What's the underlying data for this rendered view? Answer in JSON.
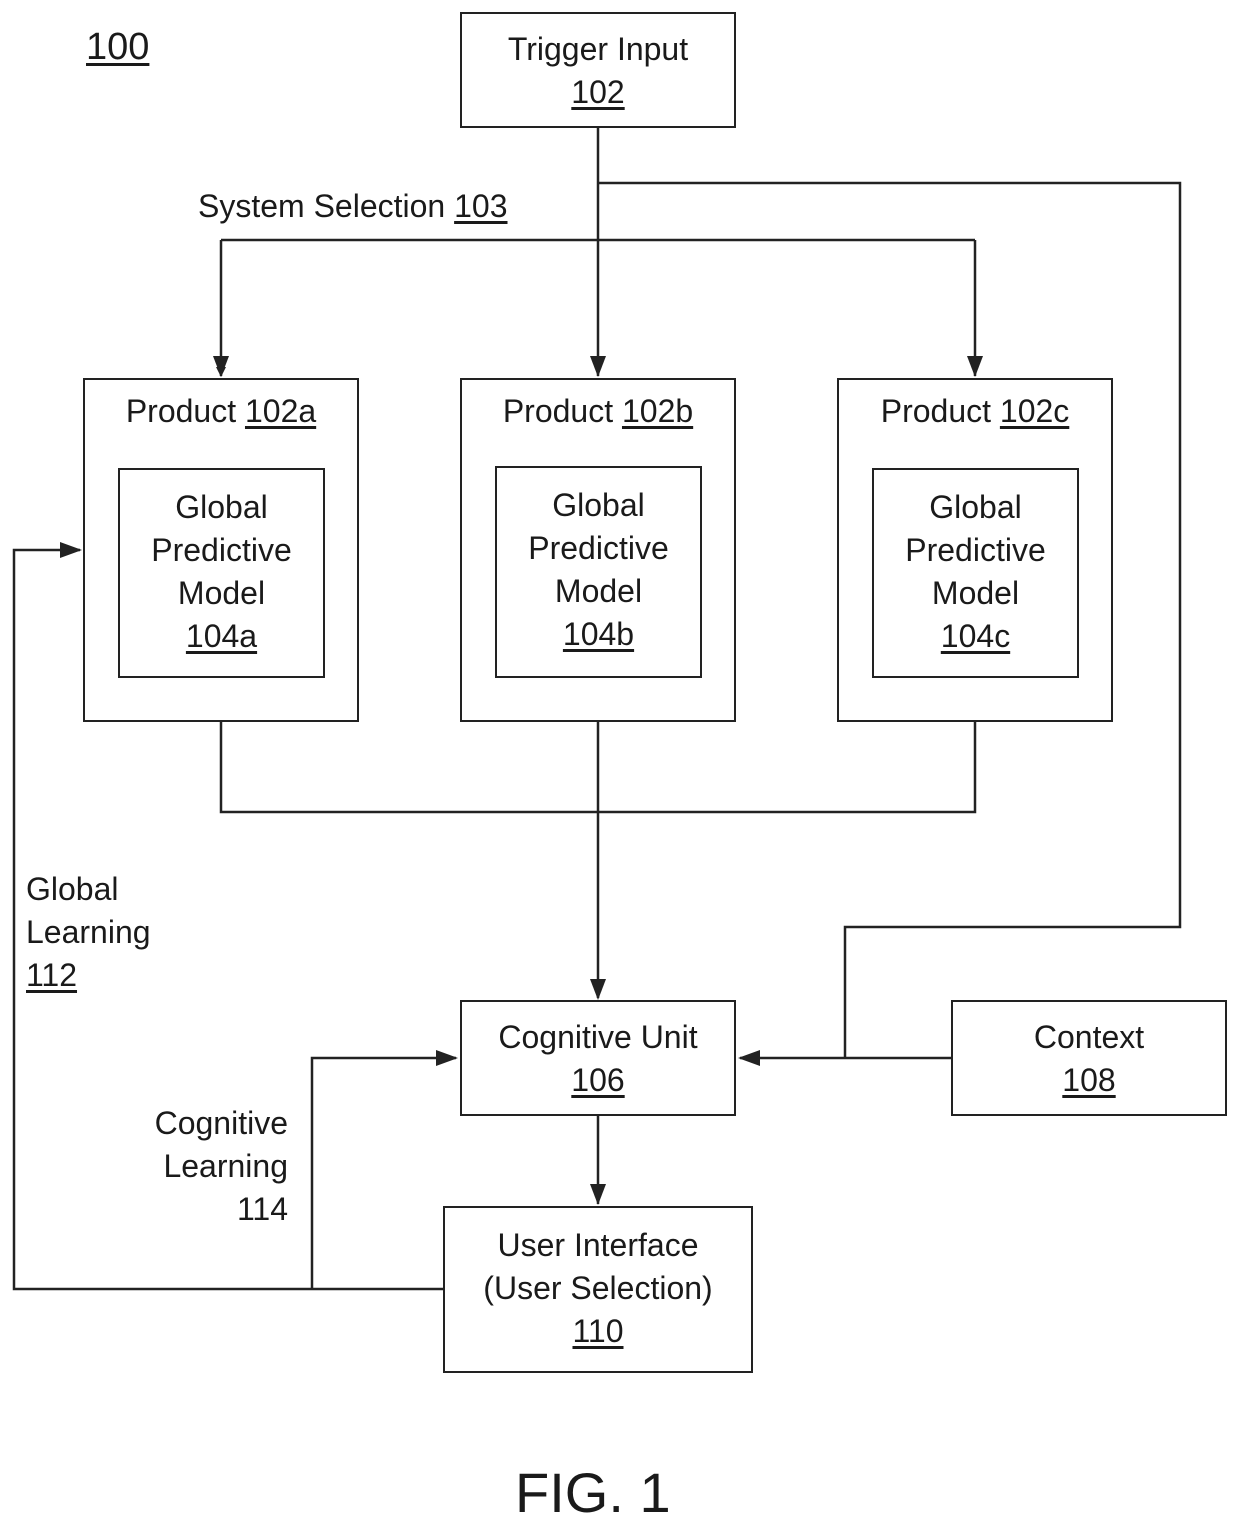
{
  "diagram": {
    "figure_ref": "100",
    "figure_caption": "FIG. 1",
    "line_color": "#222222",
    "nodes": {
      "trigger_input": {
        "label": "Trigger Input",
        "ref": "102"
      },
      "product_a": {
        "label": "Product",
        "ref": "102a",
        "model": {
          "label_lines": [
            "Global",
            "Predictive",
            "Model"
          ],
          "ref": "104a"
        }
      },
      "product_b": {
        "label": "Product",
        "ref": "102b",
        "model": {
          "label_lines": [
            "Global",
            "Predictive",
            "Model"
          ],
          "ref": "104b"
        }
      },
      "product_c": {
        "label": "Product",
        "ref": "102c",
        "model": {
          "label_lines": [
            "Global",
            "Predictive",
            "Model"
          ],
          "ref": "104c"
        }
      },
      "cognitive_unit": {
        "label": "Cognitive Unit",
        "ref": "106"
      },
      "context": {
        "label": "Context",
        "ref": "108"
      },
      "user_interface": {
        "label_lines": [
          "User Interface",
          "(User Selection)"
        ],
        "ref": "110"
      }
    },
    "edge_labels": {
      "system_selection": {
        "label": "System Selection",
        "ref": "103"
      },
      "global_learning": {
        "label_lines": [
          "Global",
          "Learning"
        ],
        "ref": "112"
      },
      "cognitive_learning": {
        "label_lines": [
          "Cognitive",
          "Learning"
        ],
        "ref": "114"
      }
    },
    "edges": [
      {
        "from": "trigger_input",
        "to": "product_a"
      },
      {
        "from": "trigger_input",
        "to": "product_b"
      },
      {
        "from": "trigger_input",
        "to": "product_c"
      },
      {
        "from": "trigger_input",
        "to": "cognitive_unit"
      },
      {
        "from": "product_a",
        "to": "cognitive_unit"
      },
      {
        "from": "product_b",
        "to": "cognitive_unit"
      },
      {
        "from": "product_c",
        "to": "cognitive_unit"
      },
      {
        "from": "context",
        "to": "cognitive_unit"
      },
      {
        "from": "cognitive_unit",
        "to": "user_interface"
      },
      {
        "from": "user_interface",
        "to": "product_a",
        "label": "global_learning"
      },
      {
        "from": "user_interface",
        "to": "cognitive_unit",
        "label": "cognitive_learning"
      }
    ]
  }
}
